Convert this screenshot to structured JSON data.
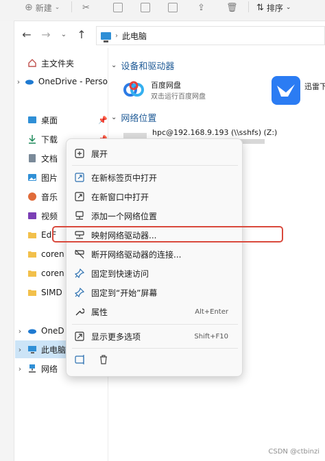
{
  "toolbar": {
    "new_label": "新建",
    "sort_label": "排序"
  },
  "address_bar": {
    "location": "此电脑"
  },
  "nav_pane": {
    "items": [
      {
        "label": "主文件夹"
      },
      {
        "label": "OneDrive - Perso"
      },
      {
        "label": "桌面"
      },
      {
        "label": "下载"
      },
      {
        "label": "文档"
      },
      {
        "label": "图片"
      },
      {
        "label": "音乐"
      },
      {
        "label": "视频"
      },
      {
        "label": "EdF"
      },
      {
        "label": "coren"
      },
      {
        "label": "coren"
      },
      {
        "label": "SIMD"
      },
      {
        "label": "OneD"
      },
      {
        "label": "此电脑"
      },
      {
        "label": "网络"
      }
    ]
  },
  "content": {
    "devices_header": "设备和驱动器",
    "baidu_name": "百度网盘",
    "baidu_sub": "双击运行百度网盘",
    "xunlei_name": "迅雷下",
    "network_header": "网络位置",
    "network_drive": "hpc@192.168.9.193 (\\\\sshfs) (Z:)"
  },
  "context_menu": {
    "items": [
      {
        "label": "展开",
        "shortcut": ""
      },
      {
        "label": "在新标签页中打开",
        "shortcut": ""
      },
      {
        "label": "在新窗口中打开",
        "shortcut": ""
      },
      {
        "label": "添加一个网络位置",
        "shortcut": ""
      },
      {
        "label": "映射网络驱动器...",
        "shortcut": ""
      },
      {
        "label": "断开网络驱动器的连接...",
        "shortcut": ""
      },
      {
        "label": "固定到快速访问",
        "shortcut": ""
      },
      {
        "label": "固定到“开始”屏幕",
        "shortcut": ""
      },
      {
        "label": "属性",
        "shortcut": "Alt+Enter"
      },
      {
        "label": "显示更多选项",
        "shortcut": "Shift+F10"
      }
    ]
  },
  "watermark": "CSDN @ctbinzi",
  "colors": {
    "accent": "#2f8fd6",
    "highlight": "#d9483b",
    "selected_bg": "#cce4f7",
    "section_header": "#1e5a96"
  }
}
